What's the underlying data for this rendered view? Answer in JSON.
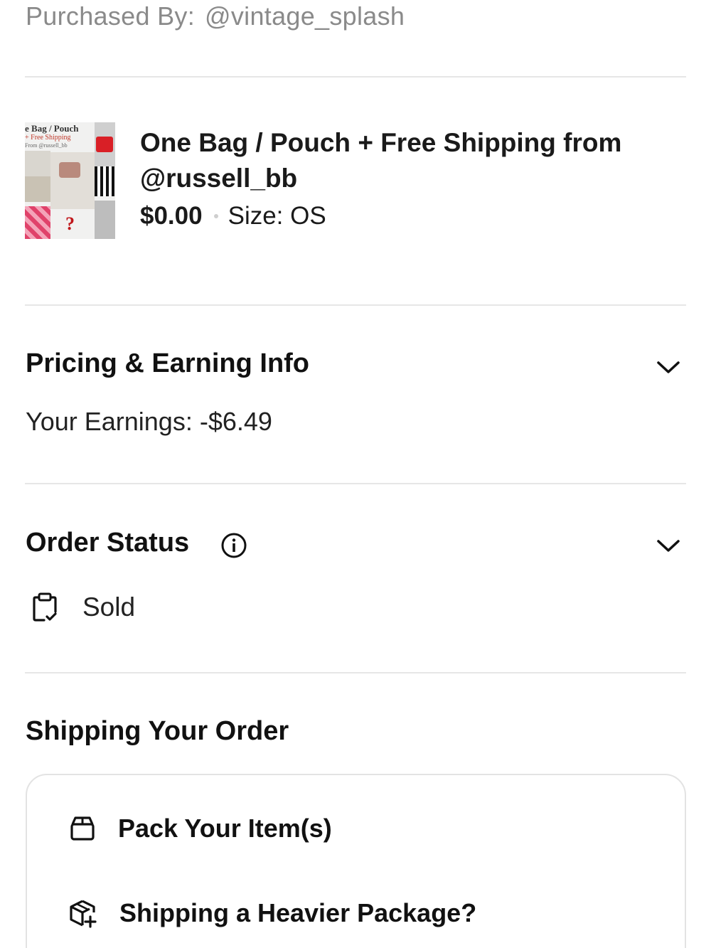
{
  "purchaser": {
    "label": "Purchased By:",
    "handle": "@vintage_splash"
  },
  "listing": {
    "thumbnail": {
      "caption_line1": "e Bag / Pouch",
      "caption_line2": "+ Free Shipping",
      "caption_line3": "From @russell_bb",
      "mark": "?"
    },
    "title": "One Bag / Pouch + Free Shipping from @russell_bb",
    "price": "$0.00",
    "size": "Size: OS"
  },
  "pricing": {
    "heading": "Pricing & Earning Info",
    "earnings": "Your Earnings: -$6.49"
  },
  "order_status": {
    "heading": "Order Status",
    "status": "Sold"
  },
  "shipping": {
    "heading": "Shipping Your Order",
    "items": [
      {
        "label": "Pack Your Item(s)",
        "icon": "box-icon"
      },
      {
        "label": "Shipping a Heavier Package?",
        "icon": "heavy-package-icon"
      }
    ]
  },
  "colors": {
    "text": "#1a1a1a",
    "muted": "#8a8a8a",
    "divider": "#e6e6e6",
    "card_border": "#e3e3e3"
  }
}
